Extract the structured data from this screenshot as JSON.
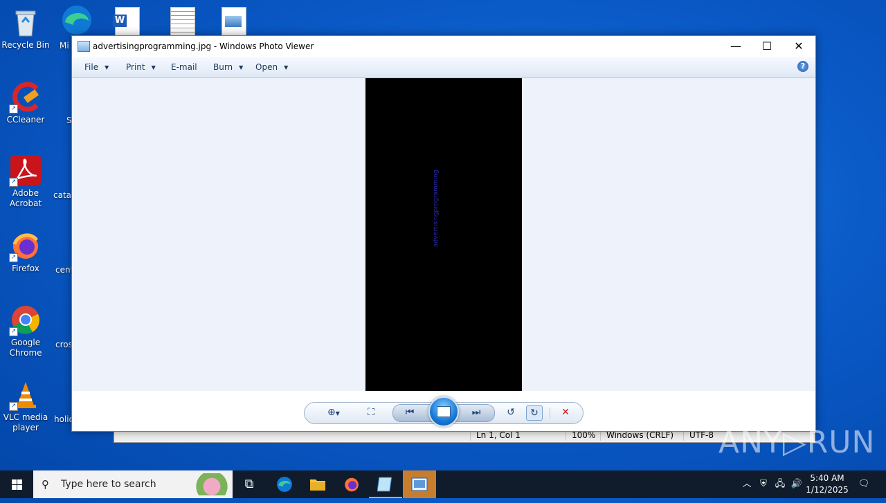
{
  "desktop": {
    "icons": [
      {
        "label": "Recycle Bin"
      },
      {
        "label": "CCleaner"
      },
      {
        "label": "Adobe Acrobat"
      },
      {
        "label": "Firefox"
      },
      {
        "label": "Google Chrome"
      },
      {
        "label": "VLC media player"
      }
    ],
    "partial_labels": [
      "Mi",
      "S",
      "catal",
      "cent",
      "cros",
      "holid"
    ]
  },
  "notepad": {
    "status": {
      "position": "Ln 1, Col 1",
      "zoom": "100%",
      "line_ending": "Windows (CRLF)",
      "encoding": "UTF-8"
    }
  },
  "window": {
    "title": "advertisingprogramming.jpg - Windows Photo Viewer",
    "minimize": "—",
    "maximize": "☐",
    "close": "✕",
    "menu": {
      "file": "File",
      "print": "Print",
      "email": "E-mail",
      "burn": "Burn",
      "open": "Open",
      "help": "?"
    },
    "photo_text": "advertisingprogramming"
  },
  "watermark": "ANY▷RUN",
  "taskbar": {
    "search_placeholder": "Type here to search",
    "time": "5:40 AM",
    "date": "1/12/2025"
  }
}
